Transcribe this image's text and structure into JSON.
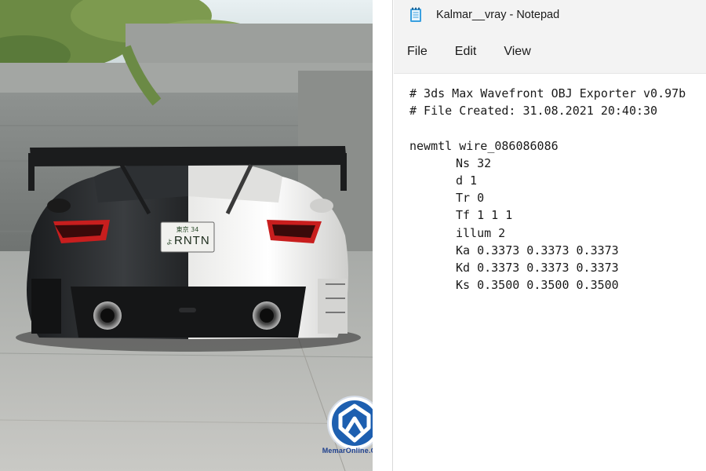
{
  "notepad": {
    "title": "Kalmar__vray - Notepad",
    "app_icon": "notepad-icon",
    "menu": [
      "File",
      "Edit",
      "View"
    ],
    "lines": [
      "# 3ds Max Wavefront OBJ Exporter v0.97b",
      "# File Created: 31.08.2021 20:40:30",
      "",
      "newmtl wire_086086086",
      "\tNs 32",
      "\td 1",
      "\tTr 0",
      "\tTf 1 1 1",
      "\tillum 2",
      "\tKa 0.3373 0.3373 0.3373",
      "\tKd 0.3373 0.3373 0.3373",
      "\tKs 0.3500 0.3500 0.3500"
    ]
  },
  "photo": {
    "license_plate": {
      "top": "東京 34",
      "bottom": "RNTN",
      "prefix": "よ"
    },
    "watermark": "MemarOnline.Com"
  },
  "colors": {
    "accent_blue": "#1d5fb0",
    "tail_light": "#c81e1e"
  }
}
